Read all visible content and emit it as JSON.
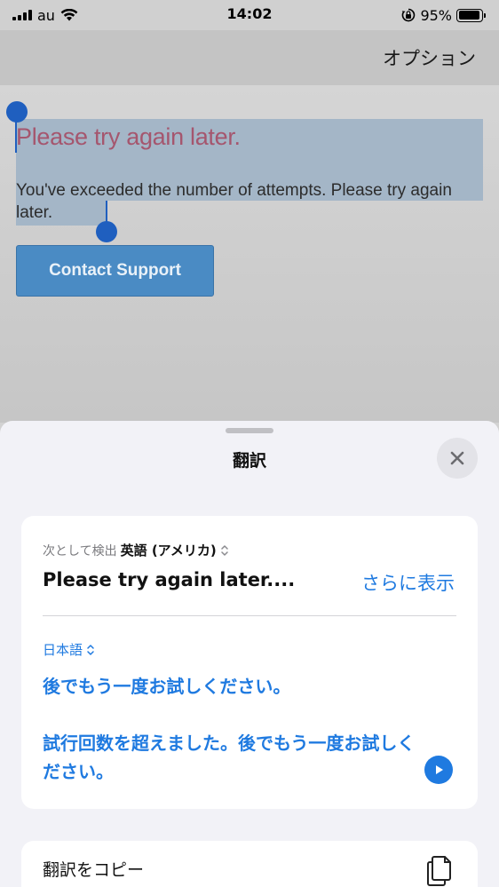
{
  "status_bar": {
    "carrier": "au",
    "time": "14:02",
    "battery_text": "95%",
    "battery_level": 0.95
  },
  "nav": {
    "options_label": "オプション"
  },
  "page": {
    "error_title": "Please try again later.",
    "error_message": "You've exceeded the number of attempts. Please try again later.",
    "contact_button": "Contact Support",
    "selection_color": "#a4b6c7",
    "handle_color": "#1f5fbf"
  },
  "sheet": {
    "title": "翻訳",
    "close_icon": "close-icon",
    "detected_prefix": "次として検出",
    "detected_language": "英語 (アメリカ)",
    "source_text": "Please try again later....",
    "show_more": "さらに表示",
    "target_language": "日本語",
    "translation_line1": "後でもう一度お試しください。",
    "translation_line2": "試行回数を超えました。後でもう一度お試しください。",
    "copy_label": "翻訳をコピー",
    "accent_color": "#1f7ae0"
  }
}
